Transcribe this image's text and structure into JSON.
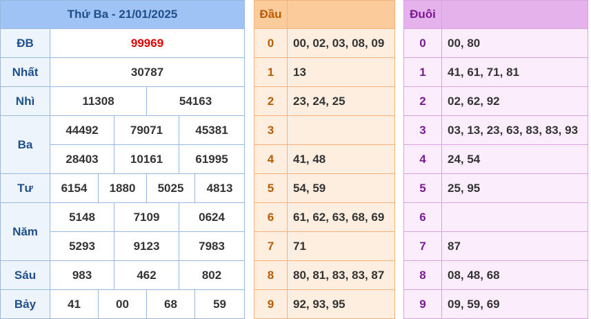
{
  "results": {
    "header": "Thứ Ba - 21/01/2025",
    "rows": [
      {
        "label": "ĐB",
        "values": [
          [
            "99969"
          ]
        ]
      },
      {
        "label": "Nhất",
        "values": [
          [
            "30787"
          ]
        ]
      },
      {
        "label": "Nhì",
        "values": [
          [
            "11308",
            "54163"
          ]
        ]
      },
      {
        "label": "Ba",
        "values": [
          [
            "44492",
            "79071",
            "45381"
          ],
          [
            "28403",
            "10161",
            "61995"
          ]
        ]
      },
      {
        "label": "Tư",
        "values": [
          [
            "6154",
            "1880",
            "5025",
            "4813"
          ]
        ]
      },
      {
        "label": "Năm",
        "values": [
          [
            "5148",
            "7109",
            "0624"
          ],
          [
            "5293",
            "9123",
            "7983"
          ]
        ]
      },
      {
        "label": "Sáu",
        "values": [
          [
            "983",
            "462",
            "802"
          ]
        ]
      },
      {
        "label": "Bảy",
        "values": [
          [
            "41",
            "00",
            "68",
            "59"
          ]
        ]
      }
    ]
  },
  "dau": {
    "header": "Đầu",
    "rows": [
      {
        "digit": "0",
        "values": "00, 02, 03, 08, 09"
      },
      {
        "digit": "1",
        "values": "13"
      },
      {
        "digit": "2",
        "values": "23, 24, 25"
      },
      {
        "digit": "3",
        "values": ""
      },
      {
        "digit": "4",
        "values": "41, 48"
      },
      {
        "digit": "5",
        "values": "54, 59"
      },
      {
        "digit": "6",
        "values": "61, 62, 63, 68, 69"
      },
      {
        "digit": "7",
        "values": "71"
      },
      {
        "digit": "8",
        "values": "80, 81, 83, 83, 87"
      },
      {
        "digit": "9",
        "values": "92, 93, 95"
      }
    ]
  },
  "duoi": {
    "header": "Đuôi",
    "rows": [
      {
        "digit": "0",
        "values": "00, 80"
      },
      {
        "digit": "1",
        "values": "41, 61, 71, 81"
      },
      {
        "digit": "2",
        "values": "02, 62, 92"
      },
      {
        "digit": "3",
        "values": "03, 13, 23, 63, 83, 83, 93"
      },
      {
        "digit": "4",
        "values": "24, 54"
      },
      {
        "digit": "5",
        "values": "25, 95"
      },
      {
        "digit": "6",
        "values": ""
      },
      {
        "digit": "7",
        "values": "87"
      },
      {
        "digit": "8",
        "values": "08, 48, 68"
      },
      {
        "digit": "9",
        "values": "09, 59, 69"
      }
    ]
  },
  "colors": {
    "special_prize": "#e00000",
    "label_blue": "#1e4f8c",
    "dau_accent": "#b85c00",
    "duoi_accent": "#7a1a94"
  }
}
